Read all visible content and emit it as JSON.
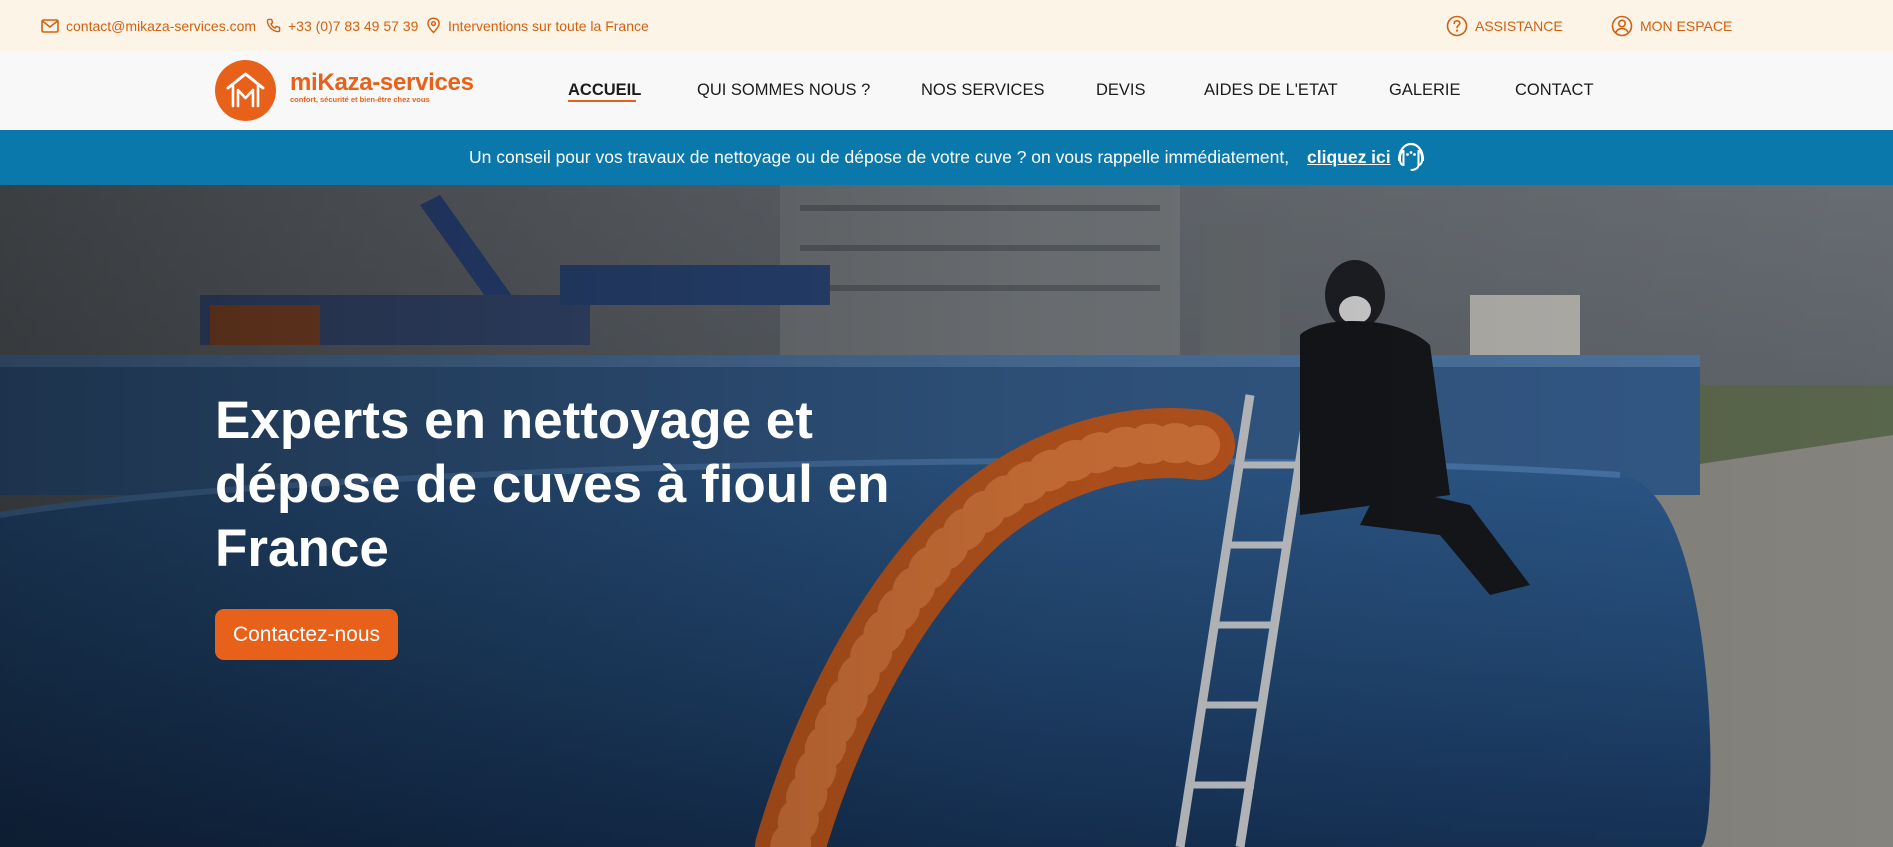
{
  "topbar": {
    "email": "contact@mikaza-services.com",
    "phone": "+33 (0)7 83 49 57 39",
    "area": "Interventions sur toute la France",
    "assistance_label": "ASSISTANCE",
    "account_label": "MON ESPACE"
  },
  "logo": {
    "name": "miKaza-services",
    "tagline": "confort, sécurité et bien-être chez vous"
  },
  "nav": {
    "active": "ACCUEIL",
    "items": [
      {
        "label": "ACCUEIL"
      },
      {
        "label": "QUI SOMMES NOUS ?"
      },
      {
        "label": "NOS SERVICES"
      },
      {
        "label": "DEVIS"
      },
      {
        "label": "AIDES DE L'ETAT"
      },
      {
        "label": "GALERIE"
      },
      {
        "label": "CONTACT"
      }
    ]
  },
  "banner": {
    "text": "Un conseil pour vos travaux de nettoyage ou de dépose de votre cuve ? on vous rappelle immédiatement,",
    "link": "cliquez ici",
    "icon": "headset-icon"
  },
  "hero": {
    "title": "Experts en nettoyage et dépose de cuves à fioul en France",
    "cta": "Contactez-nous"
  },
  "colors": {
    "accent": "#e8611a",
    "topbar_bg": "#fdf4e8",
    "banner_bg": "#0a78ab",
    "header_bg": "#f9f8f8"
  }
}
